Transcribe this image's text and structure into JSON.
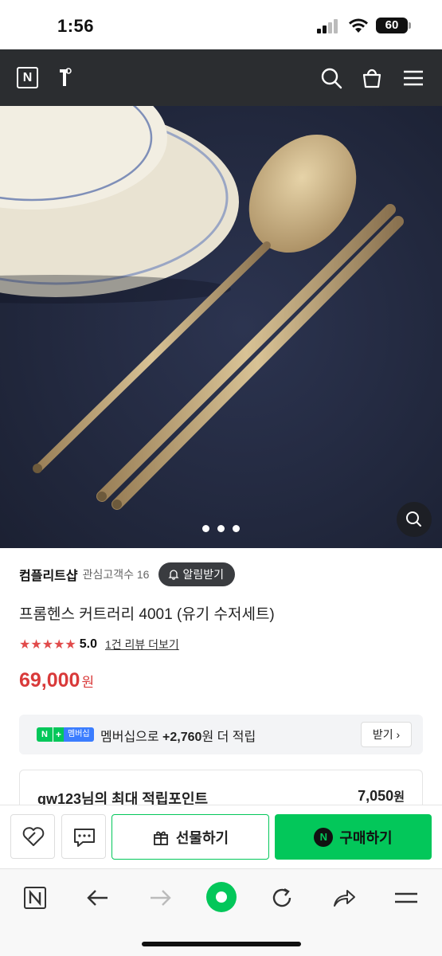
{
  "status_bar": {
    "time": "1:56",
    "battery": "60"
  },
  "header": {
    "logo_letter": "N",
    "icons": [
      "n-home-icon",
      "brand-icon",
      "search-icon",
      "cart-icon",
      "menu-icon"
    ]
  },
  "gallery": {
    "page_count": 3
  },
  "store": {
    "name": "컴플리트샵",
    "followers": "관심고객수 16",
    "alarm_label": "알림받기"
  },
  "product": {
    "title": "프롬헨스 커트러리 4001 (유기 수저세트)",
    "stars": "★★★★★",
    "rating": "5.0",
    "review_link": "1건 리뷰 더보기",
    "price": "69,000",
    "currency": "원"
  },
  "membership": {
    "badge_n": "N",
    "badge_plus": "+",
    "badge_label": "멤버십",
    "text_prefix": "멤버십으로 ",
    "amount": "+2,760",
    "text_suffix": "원 더 적립",
    "receive_label": "받기"
  },
  "points": {
    "label": "gw123님의 최대 적립포인트",
    "value": "7,050",
    "unit": "원"
  },
  "purchase_bar": {
    "gift_label": "선물하기",
    "buy_badge": "N",
    "buy_label": "구매하기"
  },
  "colors": {
    "naver_green": "#03c75a",
    "header_bg": "#2b2d30",
    "price_red": "#d93a3a",
    "star_red": "#e14b4b"
  }
}
